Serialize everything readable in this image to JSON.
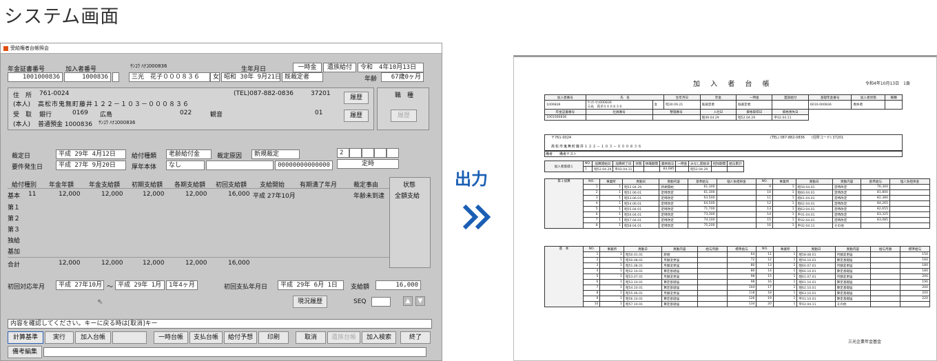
{
  "heading": "システム画面",
  "arrow_label": "出力",
  "window": {
    "title": "受給権者台帳照会",
    "hdr": {
      "l1": "年金証書番号",
      "l2": "加入者番号",
      "v1": "1001000836",
      "v2": "1000836",
      "kana": "ｻﾝｺｳ ﾊﾅｺ000836",
      "name": "三光　花子０００８３６",
      "sex": "女",
      "birth_lbl": "生年月日",
      "birth": "昭和 30年 9月21日",
      "kind": "既裁定者",
      "b1": "一時金",
      "b2": "遺族給付",
      "reiwa": "令和　4年10月13日",
      "age_lbl": "年齢",
      "age": "67歳0ヶ月"
    },
    "addr": {
      "l1": "住　所",
      "zip": "761-0024",
      "tel": "(TEL)087-882-0836",
      "code": "37201",
      "honin": "(本人)",
      "addr": "高松市鬼無町藤井１２２－１０３－０００８３６",
      "l2": "受　取",
      "bank": "銀行",
      "bno": "0169",
      "bname": "広島",
      "bno2": "022",
      "bname2": "観音",
      "bno3": "01",
      "honin2": "(本人)",
      "acct": "普通預金 1000836",
      "akana": "ｻﾝｺｳ ﾊﾅｺ000836",
      "rireki": "履歴",
      "rireki2": "履歴",
      "shokushu": "職　種",
      "rireki3": "履歴"
    },
    "sai": {
      "l1": "裁定日",
      "v1": "平成 29年 4月12日",
      "l2": "給付種類",
      "v2": "老齢給付金",
      "l3": "裁定原因",
      "v3": "新規裁定",
      "l4": "要件発生日",
      "v4": "平成 27年 9月20日",
      "l5": "厚年本体",
      "v5": "なし",
      "v6": "00000000000000",
      "n": "2",
      "teiji": "定時"
    },
    "cols": [
      "給付種別",
      "年金年額",
      "年金支給額",
      "初期支給額",
      "各期支給額",
      "初回支給額",
      "支給開始",
      "有期満了年月",
      "裁定事由",
      "状態"
    ],
    "rows": [
      {
        "k": "基本",
        "n": "11",
        "a": "12,000",
        "b": "12,000",
        "c": "12,000",
        "d": "12,000",
        "e": "16,000",
        "f": "平成 27年10月",
        "g": "",
        "h": "年齢未到達",
        "i": "全額支給"
      },
      {
        "k": "第１"
      },
      {
        "k": "第２"
      },
      {
        "k": "第３"
      },
      {
        "k": "独給"
      },
      {
        "k": "基加"
      }
    ],
    "total": {
      "k": "合計",
      "a": "12,000",
      "b": "12,000",
      "c": "12,000",
      "d": "12,000",
      "e": "16,000"
    },
    "foot": {
      "l1": "初回対応年月",
      "v1": "平成 27年10月",
      "t": "～",
      "v2": "平成 29年 1月",
      "v3": "1年4ヶ月",
      "l2": "初回支払年月日",
      "v4": "平成 29年 6月 1日",
      "l3": "支給額",
      "v5": "16,000",
      "genkyo": "現況履歴",
      "seq": "SEQ"
    },
    "msg": "内容を確認してください。キーに戻る時は[取消]キー",
    "buttons": [
      "計算基準",
      "実行",
      "加入台帳",
      "",
      "一時台帳",
      "支払台帳",
      "給付予想",
      "印刷",
      "取消",
      "遺族台帳",
      "加入検索",
      "終了"
    ],
    "bikou": "備考編集"
  },
  "doc": {
    "title": "加 入 者 台 帳",
    "date": "令和4年10月13日　1頁",
    "footer": "三光企業年金基金",
    "hdr": {
      "c1": "加入者番号",
      "c2": "氏　名",
      "c3": "生年月日",
      "c4": "年金",
      "c5": "一時金",
      "c6": "遺族給付",
      "c7": "基礎年金番号",
      "c8": "加入者状態",
      "c9": "職種",
      "v1": "1000836",
      "kana": "ｻﾝｺｳ ﾊﾅｺ000836",
      "name": "三光　花子０００８３６",
      "sex": "女",
      "birth": "昭30.09.21",
      "kind1": "既裁定者",
      "kind2": "既裁定者",
      "bno": "6010-000836",
      "state": "喪失者",
      "r2": [
        "年金証書番号",
        "社員番号",
        "整理番号",
        "入社日",
        "資格取得日",
        "資格喪失日"
      ],
      "r3": [
        "1001000836",
        "",
        "",
        "昭49.04.29",
        "昭52.04.29",
        "平02.04.11"
      ]
    },
    "addr": {
      "zip": "〒761-0024",
      "tel": "(TEL) 087-882-0836　　(住所コード) 37201",
      "line": "高松市鬼無町藤井１２２－１０３－０００８３６",
      "note": "備考",
      "notev": "備考テスト"
    },
    "kanyu": {
      "lbl": "加入者基礎１",
      "cols": [
        "NO.",
        "加算開始日",
        "加算終了日",
        "状態",
        "休職期間",
        "最終給与",
        "一時金",
        "みなし開始日",
        "控除期間",
        "給与累計"
      ],
      "vals": [
        "1",
        "昭52.04.29",
        "平02.04.11",
        "",
        "",
        "83,085",
        "",
        "昭52.04.29",
        "",
        ""
      ]
    },
    "kasan": {
      "lbl": "第１加算",
      "cols": [
        "NO.",
        "事業所",
        "異動日",
        "異動内容",
        "基準給与",
        "個人負担掛金"
      ],
      "left": [
        [
          "1",
          "1",
          "昭52.04.29",
          "新規開始",
          "61,300"
        ],
        [
          "2",
          "1",
          "昭52.06.01",
          "定時改定",
          "61,300"
        ],
        [
          "3",
          "1",
          "昭53.06.01",
          "定時改定",
          "63,500"
        ],
        [
          "4",
          "1",
          "昭54.06.01",
          "定時改定",
          "64,500"
        ],
        [
          "5",
          "1",
          "昭55.04.01",
          "定時改定",
          "71,700"
        ],
        [
          "6",
          "1",
          "昭56.04.01",
          "定時改定",
          "73,300"
        ],
        [
          "7",
          "1",
          "昭57.04.01",
          "定時改定",
          "74,100"
        ],
        [
          "8",
          "1",
          "昭58.04.01",
          "定時改定",
          "75,200"
        ]
      ],
      "right": [
        [
          "9",
          "1",
          "昭59.04.01",
          "定時改定",
          "76,300"
        ],
        [
          "10",
          "1",
          "昭60.04.01",
          "定時改定",
          "81,800"
        ],
        [
          "11",
          "1",
          "昭61.04.01",
          "定時改定",
          "82,380"
        ],
        [
          "12",
          "1",
          "昭62.04.01",
          "定時改定",
          "84,265"
        ],
        [
          "13",
          "1",
          "昭63.04.01",
          "定時改定",
          "82,655"
        ],
        [
          "14",
          "1",
          "平01.04.01",
          "定時改定",
          "83,325"
        ],
        [
          "15",
          "1",
          "平02.04.01",
          "定時改定",
          "83,085"
        ],
        [
          "16",
          "1",
          "平02.04.11",
          "その他",
          ""
        ]
      ]
    },
    "kihon": {
      "lbl": "基　本",
      "cols": [
        "NO.",
        "事業所",
        "異動日",
        "異動内容",
        "給与月額",
        "標準給与"
      ],
      "left": [
        [
          "1",
          "1",
          "昭50.01.01",
          "新規",
          "",
          "64"
        ],
        [
          "2",
          "1",
          "昭50.08.01",
          "月額変更届",
          "",
          "72"
        ],
        [
          "3",
          "1",
          "昭51.08.01",
          "月額変更届",
          "",
          "80"
        ],
        [
          "4",
          "1",
          "昭52.10.01",
          "算定基礎届",
          "",
          "86"
        ],
        [
          "5",
          "1",
          "昭53.07.01",
          "月額変更届",
          "",
          "98"
        ],
        [
          "6",
          "1",
          "昭53.10.01",
          "算定基礎届",
          "",
          "98"
        ],
        [
          "7",
          "1",
          "昭54.10.01",
          "算定基礎届",
          "",
          "104"
        ],
        [
          "8",
          "1",
          "昭55.06.01",
          "月額変更届",
          "",
          "118"
        ],
        [
          "9",
          "1",
          "昭56.10.01",
          "算定基礎届",
          "",
          "126"
        ],
        [
          "10",
          "1",
          "昭57.10.01",
          "算定基礎届",
          "",
          "134"
        ]
      ],
      "right": [
        [
          "11",
          "1",
          "昭58.08.01",
          "月額変更届",
          "",
          "150"
        ],
        [
          "12",
          "1",
          "昭59.10.01",
          "算定基礎届",
          "",
          "160"
        ],
        [
          "13",
          "1",
          "昭60.07.01",
          "月額変更届",
          "",
          "180"
        ],
        [
          "14",
          "1",
          "昭60.10.01",
          "算定基礎届",
          "",
          "180"
        ],
        [
          "15",
          "1",
          "昭61.07.01",
          "月額変更届",
          "",
          "200"
        ],
        [
          "16",
          "1",
          "昭61.10.01",
          "算定基礎届",
          "",
          "190"
        ],
        [
          "17",
          "1",
          "昭62.10.01",
          "算定基礎届",
          "",
          "200"
        ],
        [
          "18",
          "1",
          "昭63.10.01",
          "算定基礎届",
          "",
          "200"
        ],
        [
          "19",
          "1",
          "平01.10.01",
          "算定基礎届",
          "",
          "220"
        ],
        [
          "20",
          "1",
          "平02.04.11",
          "その他",
          "",
          ""
        ]
      ]
    }
  }
}
